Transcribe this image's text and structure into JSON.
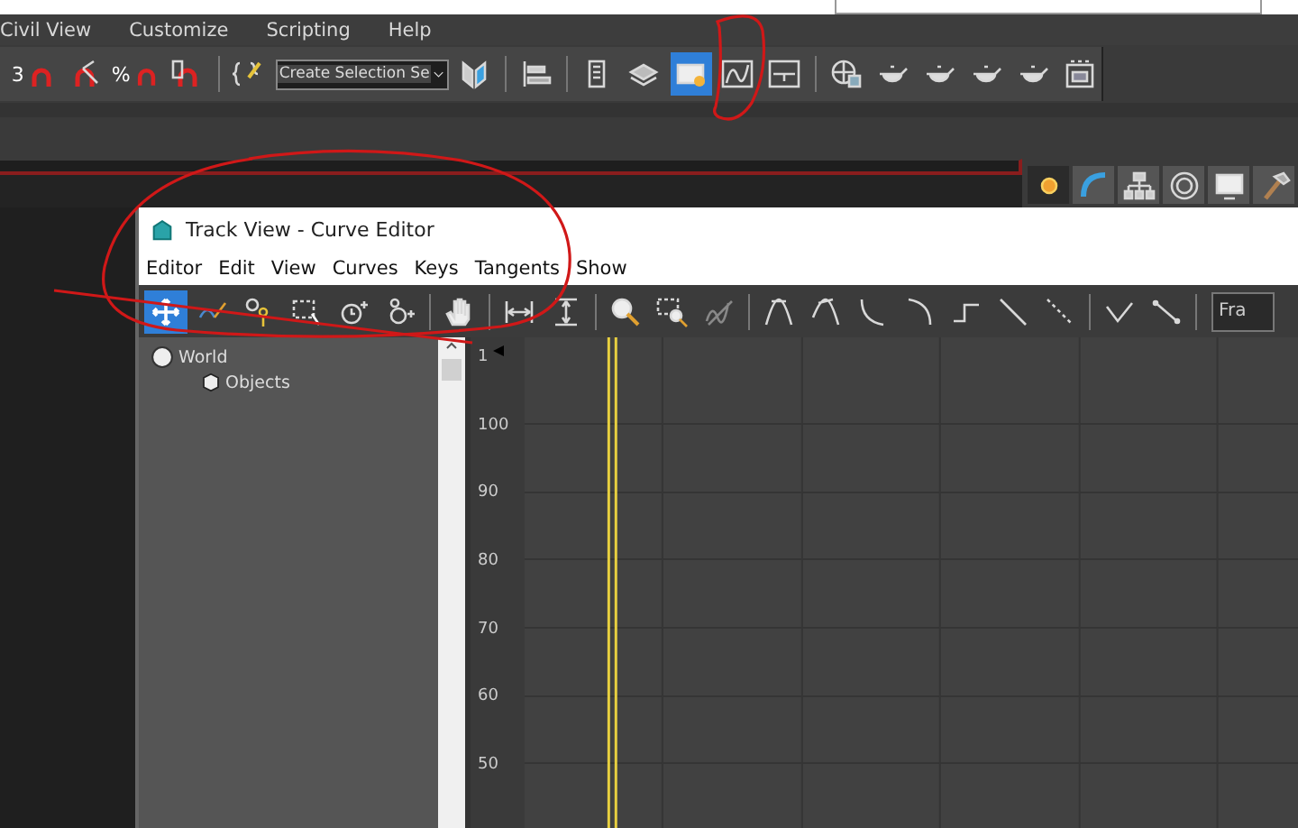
{
  "main_menu": [
    "Civil View",
    "Customize",
    "Scripting",
    "Help"
  ],
  "main_toolbar": {
    "tools_left": [
      {
        "label": "3",
        "selected": false
      },
      {
        "selected": false
      },
      {
        "label": "%",
        "selected": false
      },
      {
        "selected": false
      },
      {
        "selected": false
      }
    ],
    "selection_set": {
      "value": "Create Selection Se"
    },
    "tools_right": [
      {
        "selected": false
      },
      {
        "selected": false
      },
      {
        "selected": false
      },
      {
        "selected": false
      },
      {
        "selected": true
      },
      {
        "selected": false
      },
      {
        "selected": false
      },
      {
        "selected": false
      },
      {
        "selected": false
      },
      {
        "selected": false
      },
      {
        "selected": false
      },
      {
        "selected": false
      },
      {
        "selected": false
      }
    ]
  },
  "command_panel_tabs": [
    {
      "selected": true
    },
    {
      "selected": false
    },
    {
      "selected": false
    },
    {
      "selected": false
    },
    {
      "selected": false
    },
    {
      "selected": false
    }
  ],
  "track_view": {
    "title": "Track View - Curve Editor",
    "menu": [
      "Editor",
      "Edit",
      "View",
      "Curves",
      "Keys",
      "Tangents",
      "Show"
    ],
    "tools": [
      {
        "selected": true
      },
      {
        "selected": false
      },
      {
        "selected": false
      },
      {
        "selected": false
      },
      {
        "selected": false
      },
      {
        "selected": false
      },
      {
        "selected": false
      },
      {
        "selected": false
      },
      {
        "selected": false
      },
      {
        "selected": false
      },
      {
        "selected": false
      },
      {
        "selected": false
      },
      {
        "selected": false
      },
      {
        "selected": false
      },
      {
        "selected": false
      },
      {
        "selected": false
      },
      {
        "selected": false
      },
      {
        "selected": false
      },
      {
        "selected": false
      },
      {
        "selected": false
      },
      {
        "selected": false
      }
    ],
    "frame_field": {
      "value": "Fra"
    },
    "tree": [
      {
        "label": "World",
        "children": [
          {
            "label": "Objects"
          }
        ]
      }
    ],
    "ruler_labels": [
      "1",
      "100",
      "90",
      "80",
      "70",
      "60",
      "50"
    ]
  }
}
